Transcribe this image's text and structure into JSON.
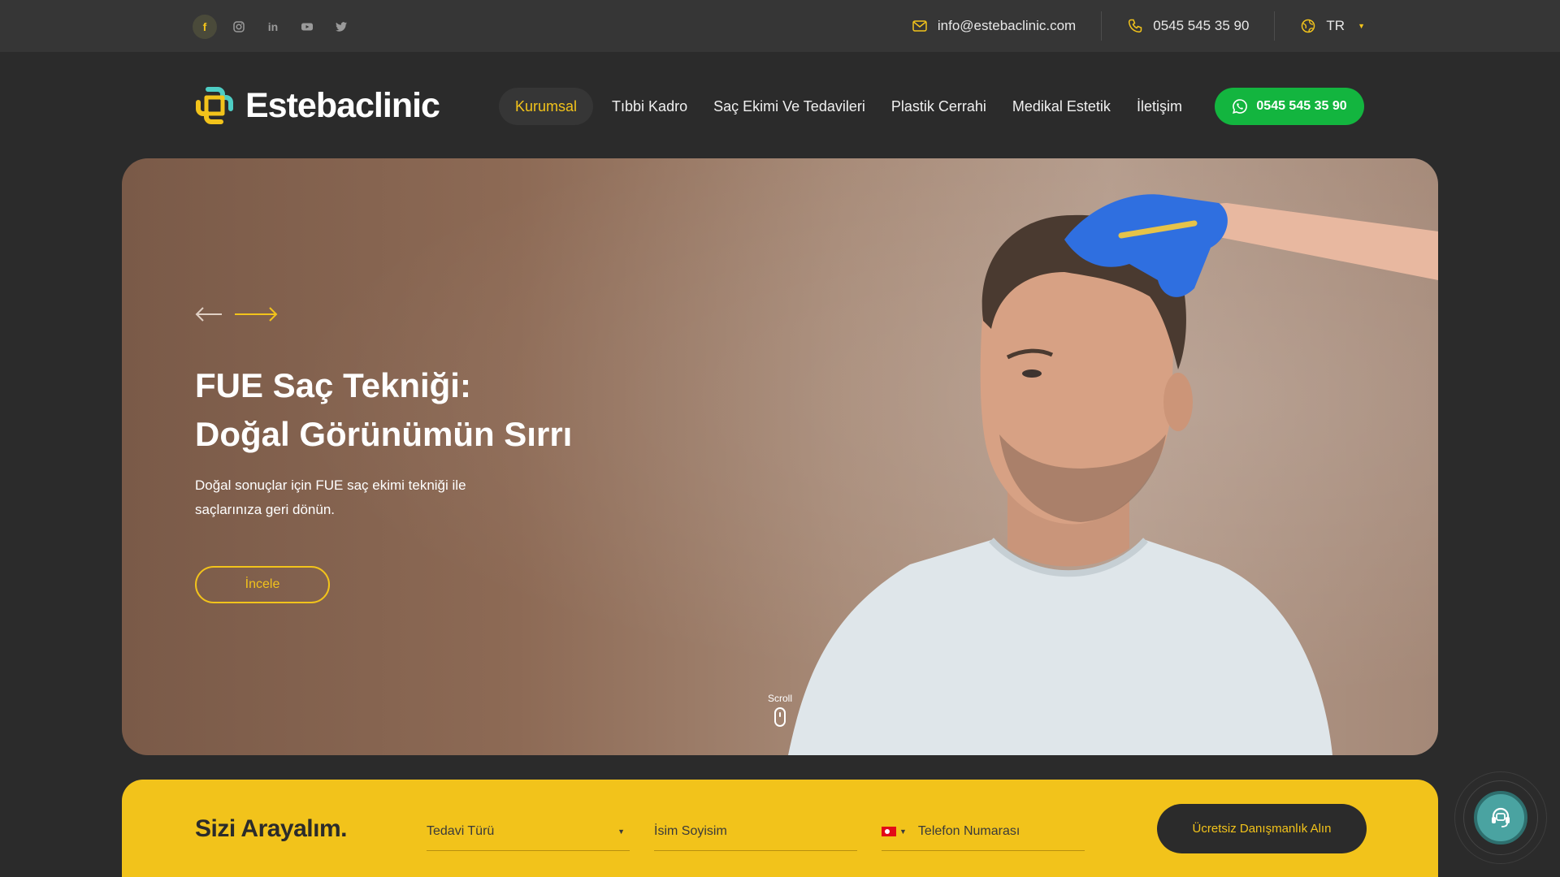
{
  "topbar": {
    "social_icons": [
      "facebook-icon",
      "instagram-icon",
      "linkedin-icon",
      "youtube-icon",
      "twitter-icon"
    ],
    "email": "info@estebaclinic.com",
    "phone": "0545 545 35 90",
    "language": "TR"
  },
  "header": {
    "logo_text": "Estebaclinic",
    "nav": [
      {
        "label": "Kurumsal",
        "active": true
      },
      {
        "label": "Tıbbi Kadro"
      },
      {
        "label": "Saç Ekimi Ve Tedavileri"
      },
      {
        "label": "Plastik Cerrahi"
      },
      {
        "label": "Medikal Estetik"
      },
      {
        "label": "İletişim"
      }
    ],
    "whatsapp_label": "0545 545 35 90"
  },
  "hero": {
    "title_line1": "FUE Saç Tekniği:",
    "title_line2": "Doğal Görünümün Sırrı",
    "description": "Doğal sonuçlar için FUE saç ekimi tekniği ile saçlarınıza geri dönün.",
    "button_label": "İncele",
    "scroll_label": "Scroll"
  },
  "form": {
    "title": "Sizi Arayalım.",
    "treatment_placeholder": "Tedavi Türü",
    "name_placeholder": "İsim Soyisim",
    "phone_placeholder": "Telefon Numarası",
    "submit_label": "Ücretsiz Danışmanlık Alın"
  },
  "colors": {
    "accent": "#f2c31b",
    "whatsapp": "#13b53f",
    "background": "#2b2b2b",
    "topbar": "#363636"
  }
}
